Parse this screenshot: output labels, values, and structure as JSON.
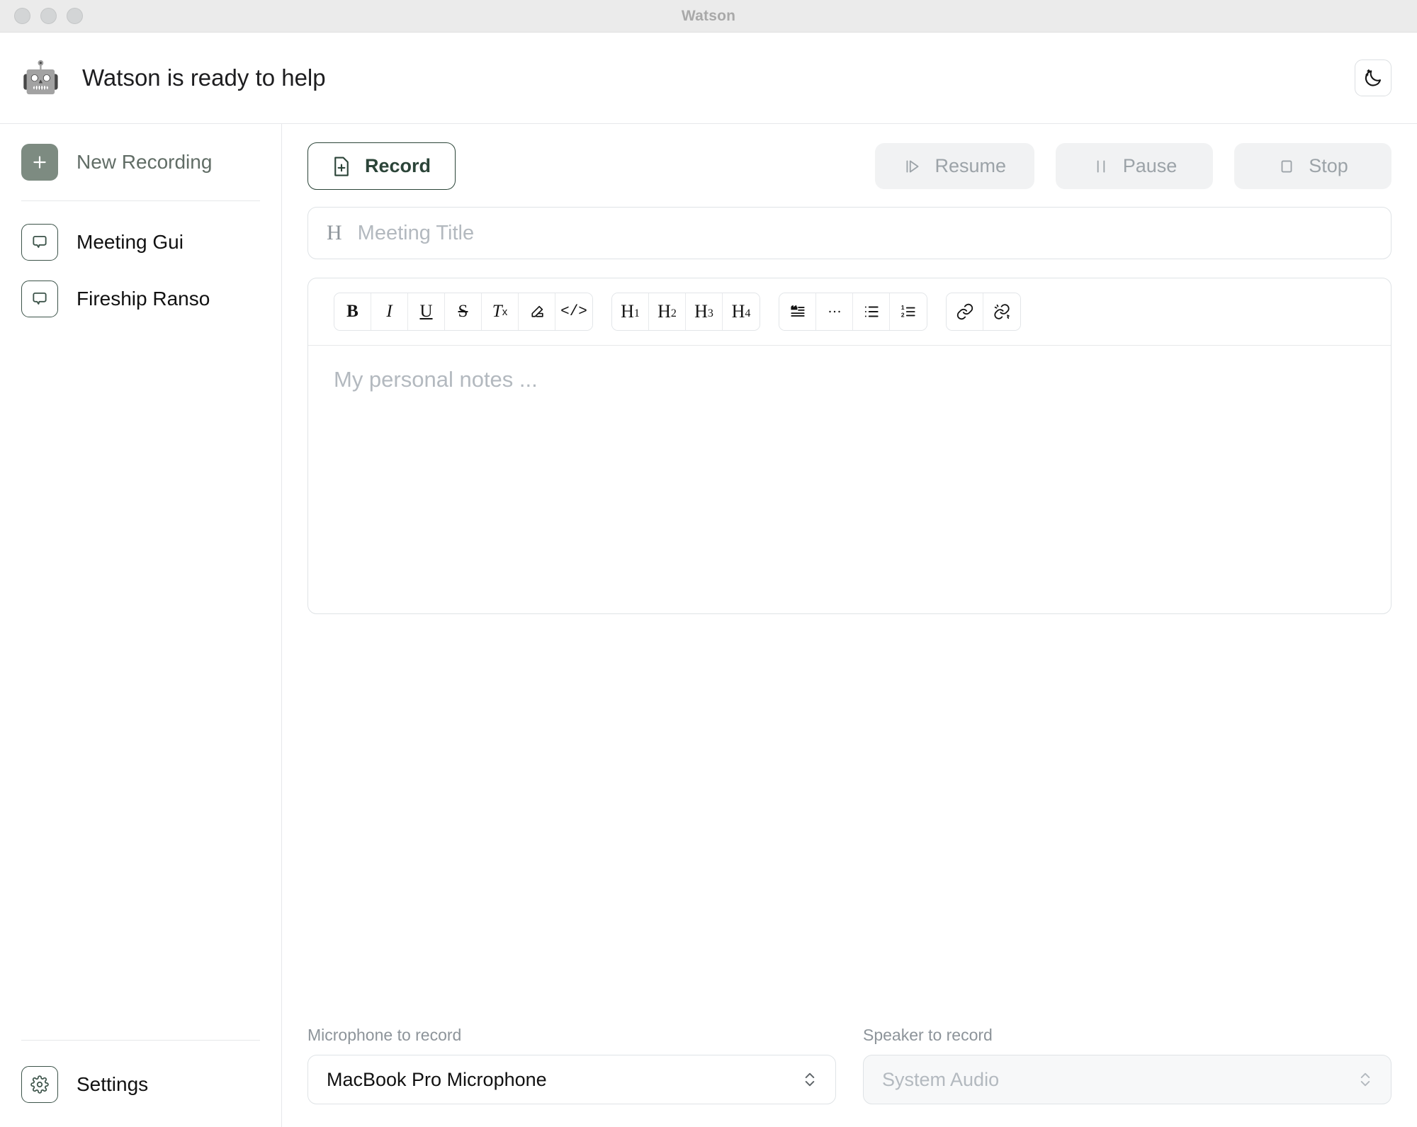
{
  "window": {
    "title": "Watson",
    "traffic_lights": [
      "close",
      "minimize",
      "zoom"
    ]
  },
  "header": {
    "avatar_icon": "robot-ghost-avatar",
    "status_text": "Watson is ready to help",
    "theme_toggle_icon": "moon-stars-icon"
  },
  "sidebar": {
    "new_recording": {
      "label": "New Recording",
      "icon": "plus-icon",
      "accent": "#7d8b81"
    },
    "items": [
      {
        "label": "Meeting Gui",
        "icon": "message-bubble-icon"
      },
      {
        "label": "Fireship Ranso",
        "icon": "message-bubble-icon"
      }
    ],
    "settings": {
      "label": "Settings",
      "icon": "gear-icon"
    }
  },
  "transport": {
    "record": {
      "label": "Record",
      "icon": "file-plus-icon",
      "enabled": true,
      "color": "#2b4438"
    },
    "resume": {
      "label": "Resume",
      "icon": "play-icon",
      "enabled": false
    },
    "pause": {
      "label": "Pause",
      "icon": "pause-icon",
      "enabled": false
    },
    "stop": {
      "label": "Stop",
      "icon": "stop-square-icon",
      "enabled": false
    }
  },
  "title_field": {
    "icon": "heading-h-icon",
    "value": "",
    "placeholder": "Meeting Title"
  },
  "editor": {
    "placeholder": "My personal notes ...",
    "value": "",
    "toolbar_groups": [
      [
        {
          "name": "bold",
          "glyph": "B"
        },
        {
          "name": "italic",
          "glyph": "I"
        },
        {
          "name": "underline",
          "glyph": "U"
        },
        {
          "name": "strikethrough",
          "glyph": "S"
        },
        {
          "name": "clear-formatting",
          "glyph": "Tx"
        },
        {
          "name": "highlight-pen",
          "glyph": "pen"
        },
        {
          "name": "code",
          "glyph": "</>"
        }
      ],
      [
        {
          "name": "heading-1",
          "glyph": "H1"
        },
        {
          "name": "heading-2",
          "glyph": "H2"
        },
        {
          "name": "heading-3",
          "glyph": "H3"
        },
        {
          "name": "heading-4",
          "glyph": "H4"
        }
      ],
      [
        {
          "name": "blockquote",
          "glyph": "quote"
        },
        {
          "name": "horizontal-rule",
          "glyph": "..."
        },
        {
          "name": "bullet-list",
          "glyph": "list"
        },
        {
          "name": "ordered-list",
          "glyph": "12list"
        }
      ],
      [
        {
          "name": "link",
          "glyph": "link"
        },
        {
          "name": "unlink",
          "glyph": "unlink"
        }
      ]
    ]
  },
  "devices": {
    "microphone": {
      "label": "Microphone to record",
      "value": "MacBook Pro Microphone",
      "enabled": true
    },
    "speaker": {
      "label": "Speaker to record",
      "value": "System Audio",
      "enabled": false
    }
  }
}
